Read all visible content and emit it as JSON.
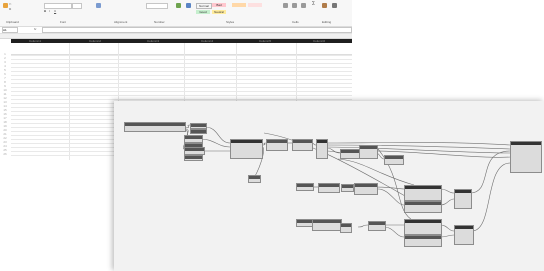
{
  "excel": {
    "name_box": "A1",
    "formula_fx": "fx",
    "ribbon_groups": [
      "Clipboard",
      "Font",
      "Alignment",
      "Number",
      "Styles",
      "Cells",
      "Editing"
    ],
    "style_swatches": [
      {
        "label": "Normal",
        "color": "#ffffff"
      },
      {
        "label": "Bad",
        "color": "#ffc7ce"
      },
      {
        "label": "Good",
        "color": "#c6efce"
      },
      {
        "label": "Neutral",
        "color": "#ffeb9c"
      }
    ],
    "header_columns": [
      "Column1",
      "Column2",
      "Column3",
      "Column4",
      "Column5",
      "Column6"
    ],
    "row_numbers": [
      "1",
      "2",
      "3",
      "4",
      "5",
      "6",
      "7",
      "8",
      "9",
      "10",
      "11",
      "12",
      "13",
      "14",
      "15",
      "16",
      "17",
      "18",
      "19",
      "20",
      "21",
      "22",
      "23",
      "24",
      "25",
      "26"
    ]
  },
  "dynamo": {
    "background": "#f2f2f2",
    "wire_color": "#6f6f6f"
  }
}
